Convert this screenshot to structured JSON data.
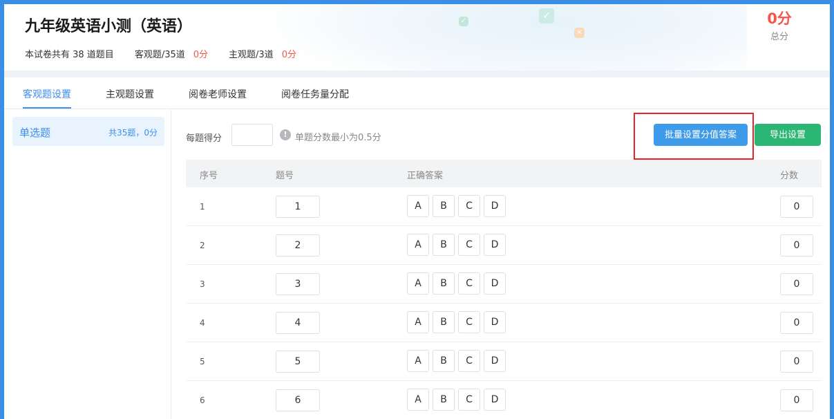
{
  "header": {
    "title": "九年级英语小测（英语）",
    "total_questions_label": "本试卷共有 38 道题目",
    "objective_label": "客观题/35道",
    "objective_score": "0分",
    "subjective_label": "主观题/3道",
    "subjective_score": "0分",
    "total_score_value": "0分",
    "total_score_label": "总分"
  },
  "tabs": [
    {
      "label": "客观题设置",
      "active": true
    },
    {
      "label": "主观题设置",
      "active": false
    },
    {
      "label": "阅卷老师设置",
      "active": false
    },
    {
      "label": "阅卷任务量分配",
      "active": false
    }
  ],
  "sidebar": {
    "items": [
      {
        "label": "单选题",
        "count": "共35题，0分"
      }
    ]
  },
  "toolbar": {
    "per_score_label": "每题得分",
    "per_score_value": "",
    "hint": "单题分数最小为0.5分",
    "batch_button": "批量设置分值答案",
    "export_button": "导出设置"
  },
  "table": {
    "headers": [
      "序号",
      "题号",
      "正确答案",
      "分数"
    ],
    "options": [
      "A",
      "B",
      "C",
      "D"
    ],
    "rows": [
      {
        "seq": "1",
        "qno": "1",
        "score": "0"
      },
      {
        "seq": "2",
        "qno": "2",
        "score": "0"
      },
      {
        "seq": "3",
        "qno": "3",
        "score": "0"
      },
      {
        "seq": "4",
        "qno": "4",
        "score": "0"
      },
      {
        "seq": "5",
        "qno": "5",
        "score": "0"
      },
      {
        "seq": "6",
        "qno": "6",
        "score": "0"
      }
    ]
  },
  "colors": {
    "accent": "#3d8ef0",
    "score_red": "#f5564a",
    "export_green": "#2bb673",
    "highlight_red": "#e8212b"
  },
  "icons": {
    "hint_icon": "info-circle-icon",
    "deco_icons": [
      "check-icon",
      "check-icon",
      "close-icon"
    ]
  }
}
